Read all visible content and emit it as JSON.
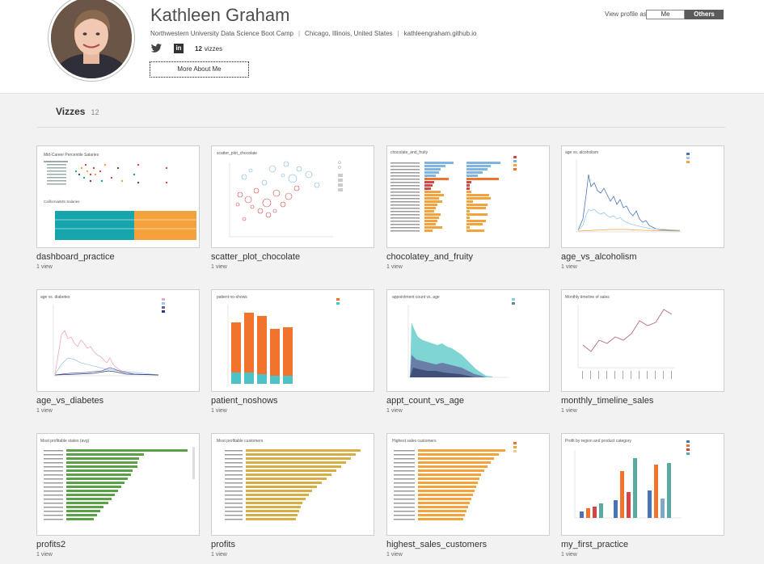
{
  "profile": {
    "name": "Kathleen Graham",
    "org": "Northwestern University Data Science Boot Camp",
    "location": "Chicago, Illinois, United States",
    "website": "kathleengraham.github.io",
    "vizzes_count": "12",
    "vizzes_label": "vizzes",
    "more_button": "More About Me"
  },
  "view_profile": {
    "label": "View profile as",
    "me": "Me",
    "others": "Others"
  },
  "section": {
    "title": "Vizzes",
    "count": "12"
  },
  "vizzes": [
    {
      "title": "dashboard_practice",
      "views": "1 view",
      "thumb_title": "Mid-Career Percentile Salaries"
    },
    {
      "title": "scatter_plot_chocolate",
      "views": "1 view",
      "thumb_title": "scatter_plot_chocolate"
    },
    {
      "title": "chocolatey_and_fruity",
      "views": "1 view",
      "thumb_title": "chocolate_and_fruity"
    },
    {
      "title": "age_vs_alcoholism",
      "views": "1 view",
      "thumb_title": "age vs. alcoholism"
    },
    {
      "title": "age_vs_diabetes",
      "views": "1 view",
      "thumb_title": "age vs. diabetes"
    },
    {
      "title": "patient_noshows",
      "views": "1 view",
      "thumb_title": "patient no-shows"
    },
    {
      "title": "appt_count_vs_age",
      "views": "1 view",
      "thumb_title": "appointment count vs. age"
    },
    {
      "title": "monthly_timeline_sales",
      "views": "1 view",
      "thumb_title": "Monthly timeline of sales"
    },
    {
      "title": "profits2",
      "views": "1 view",
      "thumb_title": "Most profitable states (avg)"
    },
    {
      "title": "profits",
      "views": "1 view",
      "thumb_title": "Most profitable customers"
    },
    {
      "title": "highest_sales_customers",
      "views": "1 view",
      "thumb_title": "Highest sales customers"
    },
    {
      "title": "my_first_practice",
      "views": "1 view",
      "thumb_title": "Profit by region and product category"
    }
  ],
  "colors": {
    "teal": "#16a4ad",
    "orange": "#f4a23c",
    "red": "#d64545",
    "blue": "#4a74b8",
    "green": "#5aa147",
    "gold": "#d6ae44",
    "dark_orange": "#f1732c"
  }
}
